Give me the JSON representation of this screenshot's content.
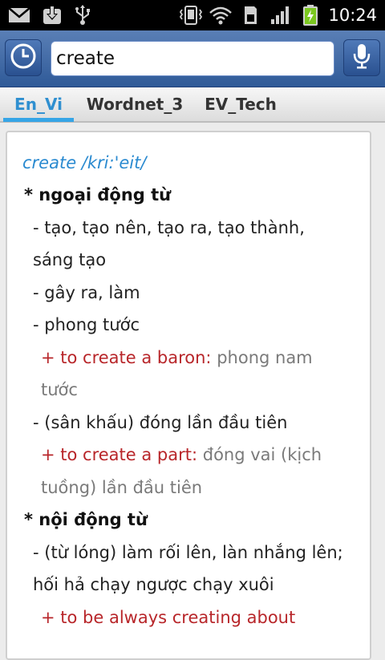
{
  "status_bar": {
    "time": "10:24",
    "icons": [
      "gmail-icon",
      "download-icon",
      "usb-icon",
      "vibrate-icon",
      "wifi-icon",
      "sd-card-icon",
      "signal-icon",
      "battery-charging-icon"
    ]
  },
  "search": {
    "value": "create",
    "history_icon": "clock-icon",
    "mic_icon": "microphone-icon"
  },
  "tabs": [
    {
      "label": "En_Vi",
      "active": true
    },
    {
      "label": "Wordnet_3",
      "active": false
    },
    {
      "label": "EV_Tech",
      "active": false
    }
  ],
  "entry": {
    "headword": "create /kri:'eit/",
    "pos1": "* ngoại động từ",
    "m1a": "- tạo, tạo nên, tạo ra, tạo thành,",
    "m1b": "sáng tạo",
    "m2": "- gây ra, làm",
    "m3": "- phong tước",
    "ex1_en": "+ to create a baron:",
    "ex1_vi_a": "phong nam",
    "ex1_vi_b": "tước",
    "m4": "- (sân khấu) đóng lần đầu tiên",
    "ex2_en": "+ to create a part:",
    "ex2_vi_a": "đóng vai (kịch",
    "ex2_vi_b": "tuồng) lần đầu tiên",
    "pos2": "* nội động từ",
    "m5a": "- (từ lóng) làm rối lên, làn nhắng lên;",
    "m5b": "hối hả chạy ngược chạy xuôi",
    "ex3_en": "+ to be always creating about"
  },
  "colors": {
    "accent": "#36a5e6",
    "headword": "#2a8ad0",
    "example_en": "#b8262a",
    "example_vi": "#7a7a7a",
    "search_bar": "#3d66a6"
  }
}
